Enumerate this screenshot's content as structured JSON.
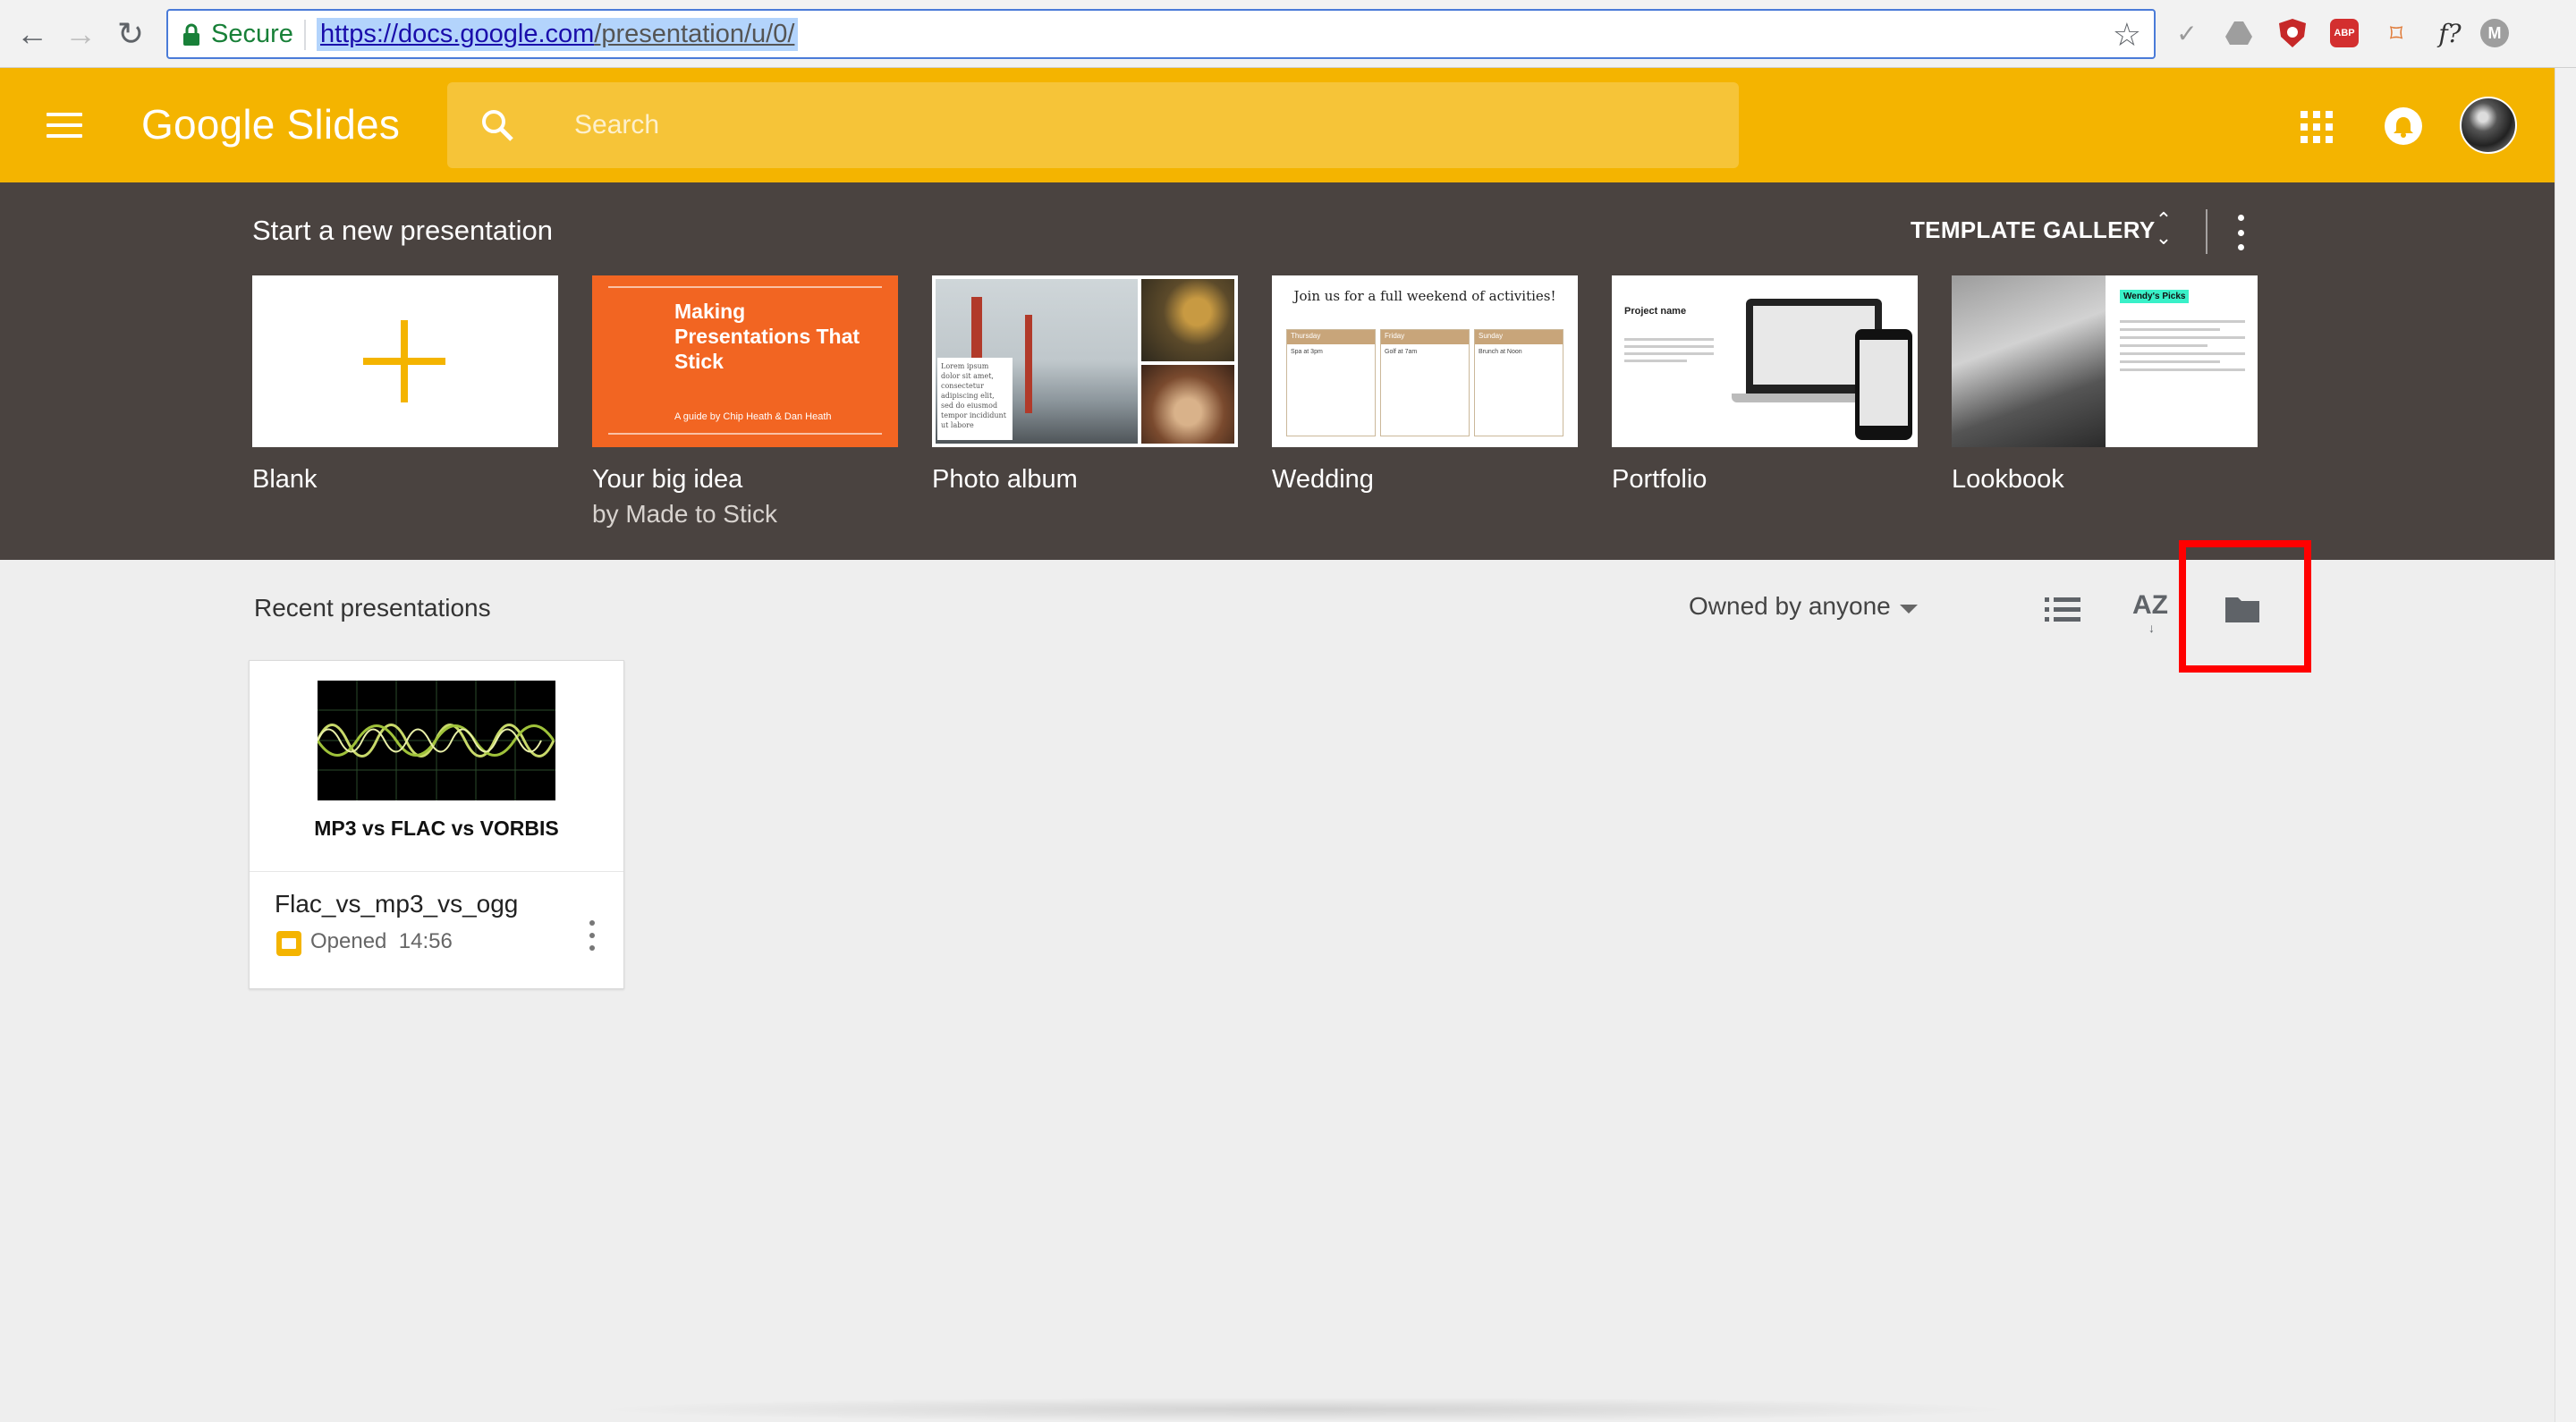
{
  "browser": {
    "secure_label": "Secure",
    "url_scheme": "https://",
    "url_host": "docs.google.com",
    "url_path": "/presentation/u/0/",
    "extensions": [
      "check-icon",
      "drive-icon",
      "ublock-icon",
      "abp-icon",
      "bookmark-icon",
      "font-icon",
      "m-icon"
    ],
    "ext_labels": {
      "abp": "ABP",
      "font": "f?",
      "m": "M"
    }
  },
  "app": {
    "logo_google": "Google",
    "logo_product": "Slides",
    "accent_color": "#f4b400",
    "search": {
      "placeholder": "Search"
    }
  },
  "templates": {
    "heading": "Start a new presentation",
    "gallery_label": "TEMPLATE GALLERY",
    "items": [
      {
        "name": "Blank",
        "sub": ""
      },
      {
        "name": "Your big idea",
        "sub": "by Made to Stick",
        "thumb_title": "Making Presentations That Stick",
        "thumb_sub": "A guide by Chip Heath & Dan Heath"
      },
      {
        "name": "Photo album",
        "sub": "",
        "thumb_text": "Lorem ipsum dolor sit amet, consectetur adipiscing elit, sed do eiusmod tempor incididunt ut labore"
      },
      {
        "name": "Wedding",
        "sub": "",
        "thumb_title": "Join us for a full weekend of activities!",
        "cols": [
          "Thursday",
          "Friday",
          "Sunday"
        ],
        "col_text": [
          "Spa at 3pm",
          "Golf at 7am",
          "Brunch at Noon"
        ]
      },
      {
        "name": "Portfolio",
        "sub": "",
        "thumb_title": "Project name"
      },
      {
        "name": "Lookbook",
        "sub": "",
        "thumb_tag": "Wendy's Picks"
      }
    ]
  },
  "recent": {
    "heading": "Recent presentations",
    "owner_filter": "Owned by anyone",
    "view_list_label": "list-view",
    "sort_label": "AZ",
    "documents": [
      {
        "slide_title": "MP3 vs FLAC vs VORBIS",
        "name": "Flac_vs_mp3_vs_ogg",
        "opened_label": "Opened",
        "opened_time": "14:56"
      }
    ]
  },
  "annotation": {
    "highlight_color": "#ff0000",
    "highlight_target": "folder-icon"
  }
}
